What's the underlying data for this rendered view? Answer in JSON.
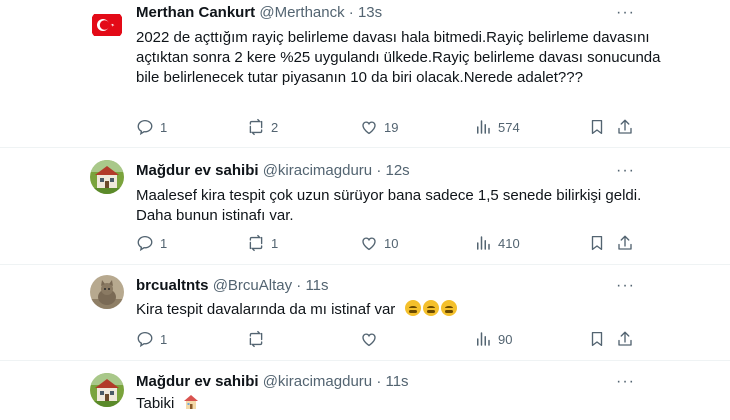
{
  "tweets": [
    {
      "name": "Merthan Cankurt",
      "handle": "@Merthanck",
      "time": "13s",
      "text": "2022 de açttığım rayiç belirleme davası hala bitmedi.Rayiç belirleme davasını açtıktan sonra 2 kere %25 uygulandı ülkede.Rayiç belirleme davası sonucunda bile belirlenecek tutar piyasanın 10 da biri olacak.Nerede adalet???",
      "replies": "1",
      "retweets": "2",
      "likes": "19",
      "views": "574",
      "avatar": "turkish-flag"
    },
    {
      "name": "Mağdur ev sahibi",
      "handle": "@kiracimagduru",
      "time": "12s",
      "text": "Maalesef kira tespit çok uzun sürüyor bana sadece 1,5 senede bilirkişi geldi. Daha bunun istinafı var.",
      "replies": "1",
      "retweets": "1",
      "likes": "10",
      "views": "410",
      "avatar": "house-photo"
    },
    {
      "name": "brcualtnts",
      "handle": "@BrcuAltay",
      "time": "11s",
      "text": "Kira tespit davalarında da mı istinaf var",
      "emojis": [
        "weary-face",
        "weary-face",
        "weary-face"
      ],
      "replies": "1",
      "retweets": "",
      "likes": "",
      "views": "90",
      "avatar": "cat-photo"
    },
    {
      "name": "Mağdur ev sahibi",
      "handle": "@kiracimagduru",
      "time": "11s",
      "text": "Tabiki",
      "emojis": [
        "house-emoji"
      ],
      "avatar": "house-photo"
    }
  ],
  "dot": "·",
  "more_label": "···",
  "colors": {
    "text": "#0f1419",
    "muted": "#536471",
    "separator": "#eff3f4"
  }
}
